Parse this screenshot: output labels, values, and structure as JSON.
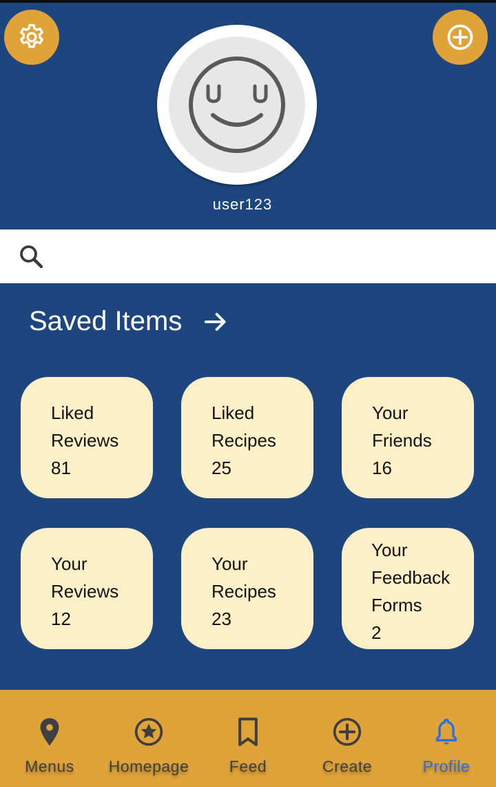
{
  "profile": {
    "username": "user123"
  },
  "search": {
    "placeholder": ""
  },
  "saved": {
    "title": "Saved Items",
    "cards": [
      {
        "line1": "Liked",
        "line2": "Reviews",
        "count": "81"
      },
      {
        "line1": "Liked",
        "line2": "Recipes",
        "count": "25"
      },
      {
        "line1": "Your",
        "line2": "Friends",
        "count": "16"
      },
      {
        "line1": "Your",
        "line2": "Reviews",
        "count": "12"
      },
      {
        "line1": "Your",
        "line2": "Recipes",
        "count": "23"
      },
      {
        "line1": "Your",
        "line2": "Feedback",
        "line3": "Forms",
        "count": "2"
      }
    ]
  },
  "nav": {
    "items": [
      {
        "label": "Menus",
        "icon": "map-pin-icon"
      },
      {
        "label": "Homepage",
        "icon": "star-circle-icon"
      },
      {
        "label": "Feed",
        "icon": "bookmark-icon"
      },
      {
        "label": "Create",
        "icon": "plus-circle-icon"
      },
      {
        "label": "Profile",
        "icon": "bell-icon"
      }
    ],
    "active": "Profile"
  },
  "colors": {
    "primary_blue": "#1c467d",
    "accent_gold": "#e0a33a",
    "card_cream": "#fdf0c8",
    "active_blue": "#2a6fdb"
  }
}
